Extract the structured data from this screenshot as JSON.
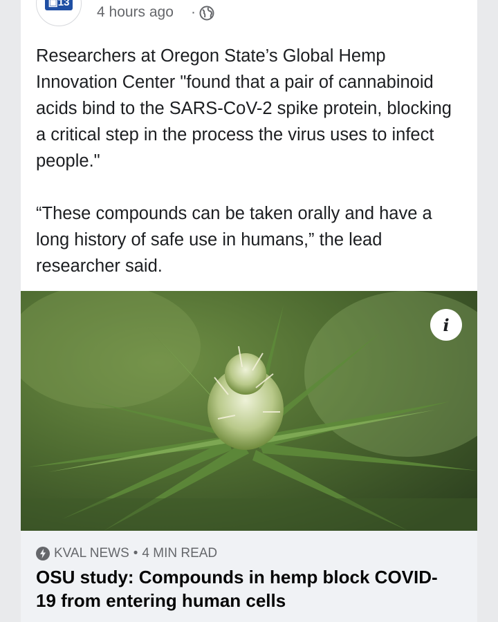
{
  "post": {
    "timestamp": "4 hours ago",
    "separator": "·",
    "paragraphs": [
      "Researchers at Oregon State’s Global Hemp Innovation Center \"found that a pair of cannabinoid acids bind to the SARS-CoV-2 spike protein, blocking a critical step in the process the virus uses to infect people.\"",
      "“These compounds can be taken orally and have a long history of safe use in humans,” the lead researcher said."
    ]
  },
  "image": {
    "info_label": "i",
    "subject_icon": "cannabis-plant-photo"
  },
  "link": {
    "source": "KVAL NEWS",
    "separator": "•",
    "read_time": "4 MIN READ",
    "title": "OSU study: Compounds in hemp block COVID-19 from entering human cells"
  },
  "colors": {
    "text_primary": "#1c1e21",
    "text_secondary": "#65676b",
    "preview_bg": "#f0f2f5",
    "page_bg": "#e9eaec"
  }
}
